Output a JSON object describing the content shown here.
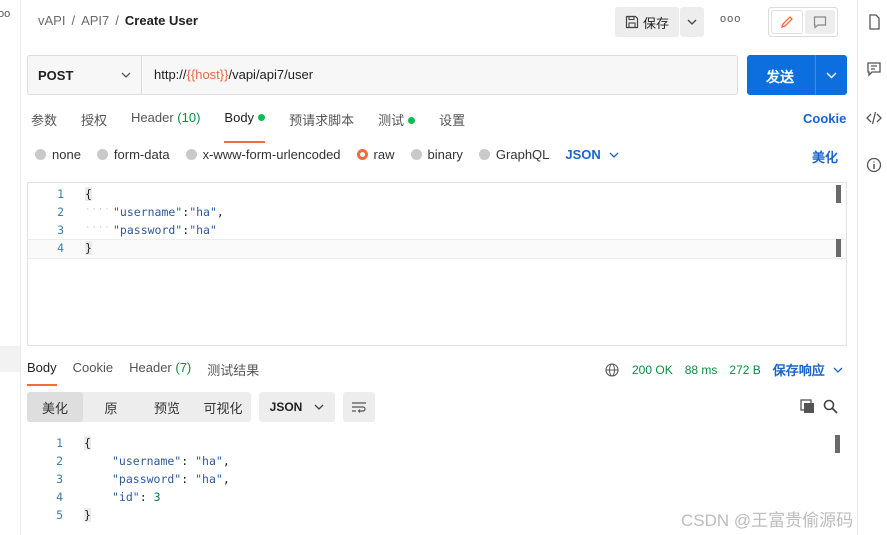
{
  "breadcrumb": {
    "workspace": "vAPI",
    "sep1": "/",
    "collection": "API7",
    "sep2": "/",
    "request": "Create User"
  },
  "toolbar": {
    "save_label": "保存",
    "more_label": "ooo"
  },
  "request": {
    "method": "POST",
    "url_prefix": "http://",
    "url_var": "{{host}}",
    "url_suffix": "/vapi/api7/user",
    "send_label": "发送"
  },
  "req_tabs": [
    {
      "label": "参数",
      "count": ""
    },
    {
      "label": "授权",
      "count": ""
    },
    {
      "label": "Header",
      "count": "(10)"
    },
    {
      "label": "Body",
      "count": ""
    },
    {
      "label": "预请求脚本",
      "count": ""
    },
    {
      "label": "测试",
      "count": ""
    },
    {
      "label": "设置",
      "count": ""
    }
  ],
  "cookie_link": "Cookie",
  "body_modes": [
    "none",
    "form-data",
    "x-www-form-urlencoded",
    "raw",
    "binary",
    "GraphQL"
  ],
  "body_format": "JSON",
  "beautify": "美化",
  "req_body": {
    "lines": [
      "1",
      "2",
      "3",
      "4"
    ],
    "brace_open": "{",
    "l2_key": "\"username\"",
    "l2_colon": ":",
    "l2_val": "\"ha\"",
    "l2_comma": ",",
    "l3_key": "\"password\"",
    "l3_colon": ":",
    "l3_val": "\"ha\"",
    "brace_close": "}"
  },
  "resp_tabs": [
    {
      "label": "Body",
      "count": ""
    },
    {
      "label": "Cookie",
      "count": ""
    },
    {
      "label": "Header",
      "count": "(7)"
    },
    {
      "label": "测试结果",
      "count": ""
    }
  ],
  "resp_status": {
    "code": "200 OK",
    "time": "88 ms",
    "size": "272 B",
    "save": "保存响应"
  },
  "resp_views": [
    "美化",
    "原",
    "预览",
    "可视化"
  ],
  "resp_format": "JSON",
  "resp_body": {
    "lines": [
      "1",
      "2",
      "3",
      "4",
      "5"
    ],
    "brace_open": "{",
    "l2_key": "\"username\"",
    "l2_colon": ":",
    "l2_val": "\"ha\"",
    "l2_comma": ",",
    "l3_key": "\"password\"",
    "l3_colon": ":",
    "l3_val": "\"ha\"",
    "l3_comma": ",",
    "l4_key": "\"id\"",
    "l4_colon": ":",
    "l4_val": "3",
    "brace_close": "}"
  },
  "watermark": "CSDN @王富贵偷源码",
  "colors": {
    "accent": "#f26b3a",
    "primary": "#0d6fde",
    "success": "#0cbb52",
    "var": "#e8684a"
  }
}
